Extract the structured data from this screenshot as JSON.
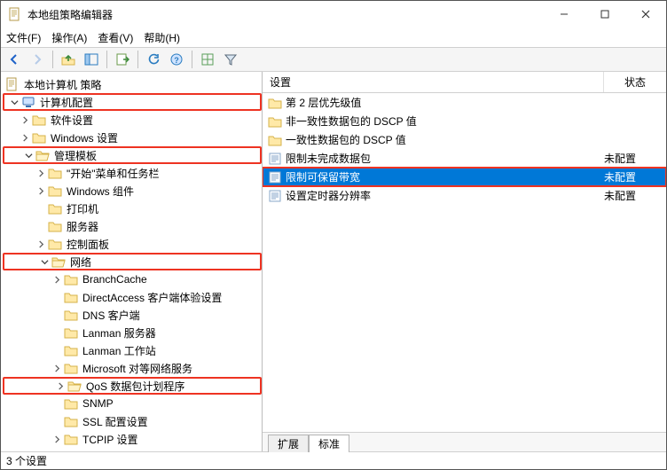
{
  "window": {
    "title": "本地组策略编辑器"
  },
  "menu": {
    "file": "文件(F)",
    "action": "操作(A)",
    "view": "查看(V)",
    "help": "帮助(H)"
  },
  "tree": {
    "root": "本地计算机 策略",
    "computer_config": "计算机配置",
    "software_settings": "软件设置",
    "windows_settings": "Windows 设置",
    "admin_templates": "管理模板",
    "start_taskbar": "\"开始\"菜单和任务栏",
    "windows_components": "Windows 组件",
    "printers": "打印机",
    "servers": "服务器",
    "control_panel": "控制面板",
    "network": "网络",
    "branchcache": "BranchCache",
    "directaccess": "DirectAccess 客户端体验设置",
    "dns_client": "DNS 客户端",
    "lanman_server": "Lanman 服务器",
    "lanman_workstation": "Lanman 工作站",
    "ms_p2p": "Microsoft 对等网络服务",
    "qos": "QoS 数据包计划程序",
    "snmp": "SNMP",
    "ssl_config": "SSL 配置设置",
    "tcpip": "TCPIP 设置"
  },
  "columns": {
    "setting": "设置",
    "state": "状态"
  },
  "list": {
    "items": [
      {
        "name": "第 2 层优先级值",
        "state": "",
        "type": "folder"
      },
      {
        "name": "非一致性数据包的 DSCP 值",
        "state": "",
        "type": "folder"
      },
      {
        "name": "一致性数据包的 DSCP 值",
        "state": "",
        "type": "folder"
      },
      {
        "name": "限制未完成数据包",
        "state": "未配置",
        "type": "setting"
      },
      {
        "name": "限制可保留带宽",
        "state": "未配置",
        "type": "setting",
        "selected": true
      },
      {
        "name": "设置定时器分辨率",
        "state": "未配置",
        "type": "setting"
      }
    ]
  },
  "tabs": {
    "extended": "扩展",
    "standard": "标准"
  },
  "status": "3 个设置"
}
